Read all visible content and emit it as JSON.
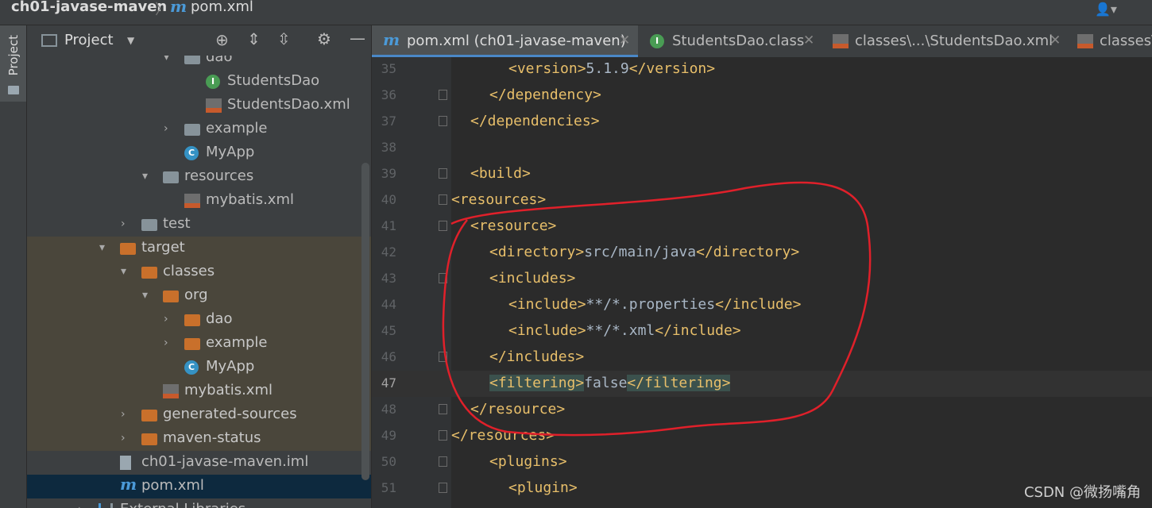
{
  "breadcrumb": {
    "project": "ch01-javase-maven",
    "sep": "〉",
    "file_icon": "m",
    "file": "pom.xml"
  },
  "stripe": {
    "label": "Project"
  },
  "panel": {
    "title": "Project",
    "dropdown": "▼"
  },
  "tree": [
    {
      "label": "dao",
      "icon": "folder-grey-icon",
      "indent": 1,
      "arrow": "▾",
      "excluded": false
    },
    {
      "label": "StudentsDao",
      "icon": "interface-icon",
      "indent": 2,
      "arrow": "",
      "excluded": false
    },
    {
      "label": "StudentsDao.xml",
      "icon": "xml-file-icon",
      "indent": 2,
      "arrow": "",
      "excluded": false
    },
    {
      "label": "example",
      "icon": "folder-grey-icon",
      "indent": 1,
      "arrow": "›",
      "excluded": false
    },
    {
      "label": "MyApp",
      "icon": "class-icon",
      "indent": 1,
      "arrow": "",
      "excluded": false
    },
    {
      "label": "resources",
      "icon": "resources-folder-icon",
      "indent": 0,
      "arrow": "▾",
      "excluded": false
    },
    {
      "label": "mybatis.xml",
      "icon": "xml-file-icon",
      "indent": 1,
      "arrow": "",
      "excluded": false
    },
    {
      "label": "test",
      "icon": "folder-grey-icon",
      "indent": -1,
      "arrow": "›",
      "excluded": false
    },
    {
      "label": "target",
      "icon": "folder-orange-icon",
      "indent": -2,
      "arrow": "▾",
      "excluded": true
    },
    {
      "label": "classes",
      "icon": "folder-orange-icon",
      "indent": -1,
      "arrow": "▾",
      "excluded": true
    },
    {
      "label": "org",
      "icon": "folder-orange-icon",
      "indent": 0,
      "arrow": "▾",
      "excluded": true
    },
    {
      "label": "dao",
      "icon": "folder-orange-icon",
      "indent": 1,
      "arrow": "›",
      "excluded": true
    },
    {
      "label": "example",
      "icon": "folder-orange-icon",
      "indent": 1,
      "arrow": "›",
      "excluded": true
    },
    {
      "label": "MyApp",
      "icon": "class-icon",
      "indent": 1,
      "arrow": "",
      "excluded": true
    },
    {
      "label": "mybatis.xml",
      "icon": "xml-file-icon",
      "indent": 0,
      "arrow": "",
      "excluded": true
    },
    {
      "label": "generated-sources",
      "icon": "folder-orange-icon",
      "indent": -1,
      "arrow": "›",
      "excluded": true
    },
    {
      "label": "maven-status",
      "icon": "folder-orange-icon",
      "indent": -1,
      "arrow": "›",
      "excluded": true
    },
    {
      "label": "ch01-javase-maven.iml",
      "icon": "iml-file-icon",
      "indent": -2,
      "arrow": "",
      "excluded": false
    },
    {
      "label": "pom.xml",
      "icon": "maven-icon",
      "indent": -2,
      "arrow": "",
      "excluded": false,
      "selected": true
    },
    {
      "label": "External Libraries",
      "icon": "libraries-icon",
      "indent": -3,
      "arrow": "›",
      "excluded": false
    }
  ],
  "tabs": [
    {
      "label": "pom.xml (ch01-javase-maven)",
      "icon": "maven-icon",
      "active": true
    },
    {
      "label": "StudentsDao.class",
      "icon": "interface-icon",
      "active": false
    },
    {
      "label": "classes\\...\\StudentsDao.xml",
      "icon": "xml-file-icon",
      "active": false
    },
    {
      "label": "classes\\",
      "icon": "xml-file-icon",
      "active": false
    }
  ],
  "editor": {
    "current_line": "47",
    "lines": [
      {
        "n": "35",
        "indent": 3,
        "open": "<version>",
        "text": "5.1.9",
        "close": "</version>"
      },
      {
        "n": "36",
        "indent": 2,
        "open": "",
        "text": "",
        "close": "</dependency>"
      },
      {
        "n": "37",
        "indent": 1,
        "open": "",
        "text": "",
        "close": "</dependencies>"
      },
      {
        "n": "38",
        "indent": 0,
        "open": "",
        "text": "",
        "close": ""
      },
      {
        "n": "39",
        "indent": 1,
        "open": "<build>",
        "text": "",
        "close": ""
      },
      {
        "n": "40",
        "indent": 0,
        "open": "<resources>",
        "text": "",
        "close": ""
      },
      {
        "n": "41",
        "indent": 1,
        "open": "<resource>",
        "text": "",
        "close": ""
      },
      {
        "n": "42",
        "indent": 2,
        "open": "<directory>",
        "text": "src/main/java",
        "close": "</directory>"
      },
      {
        "n": "43",
        "indent": 2,
        "open": "<includes>",
        "text": "",
        "close": ""
      },
      {
        "n": "44",
        "indent": 3,
        "open": "<include>",
        "text": "**/*.properties",
        "close": "</include>"
      },
      {
        "n": "45",
        "indent": 3,
        "open": "<include>",
        "text": "**/*.xml",
        "close": "</include>"
      },
      {
        "n": "46",
        "indent": 2,
        "open": "",
        "text": "",
        "close": "</includes>"
      },
      {
        "n": "47",
        "indent": 2,
        "open": "<filtering>",
        "text": "false",
        "close": "</filtering>"
      },
      {
        "n": "48",
        "indent": 1,
        "open": "",
        "text": "",
        "close": "</resource>"
      },
      {
        "n": "49",
        "indent": 0,
        "open": "",
        "text": "",
        "close": "</resources>"
      },
      {
        "n": "50",
        "indent": 2,
        "open": "<plugins>",
        "text": "",
        "close": ""
      },
      {
        "n": "51",
        "indent": 3,
        "open": "<plugin>",
        "text": "",
        "close": ""
      }
    ]
  },
  "watermark": "CSDN @微扬嘴角"
}
